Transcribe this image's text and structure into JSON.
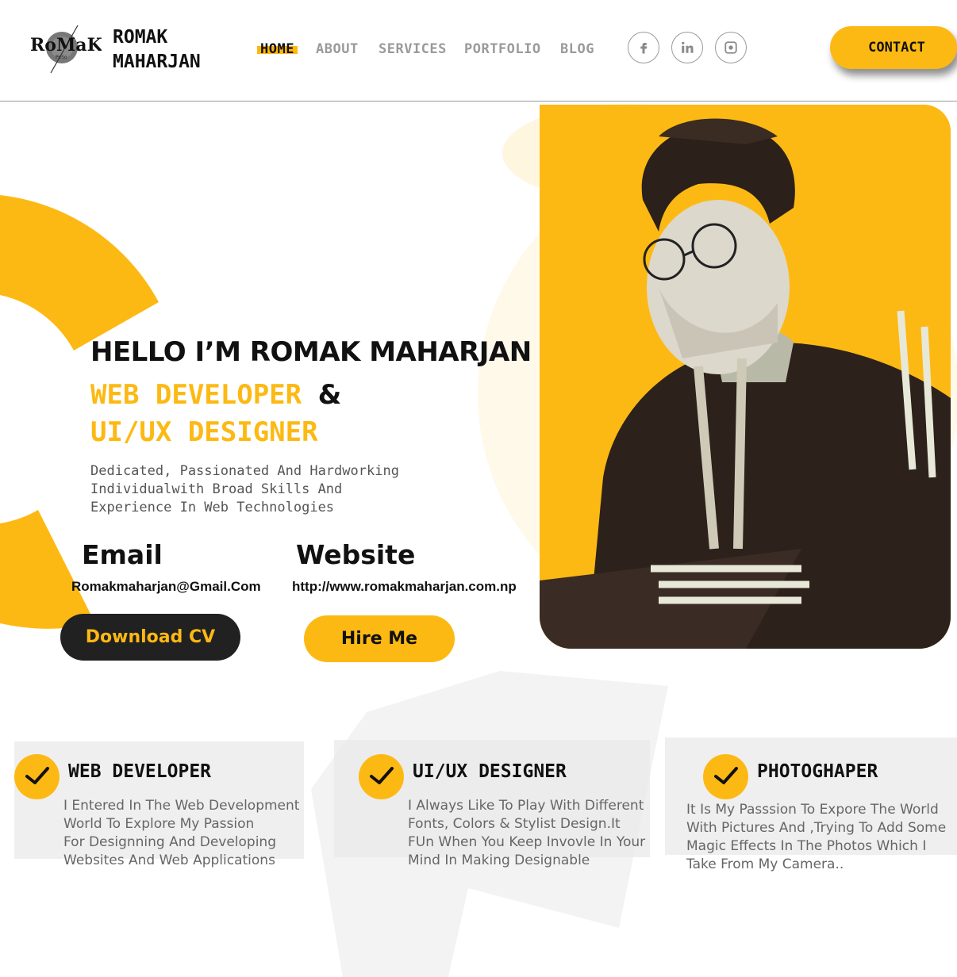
{
  "header": {
    "brand_line1": "ROMAK",
    "brand_line2": "MAHARJAN",
    "logo_text": "RoMaK",
    "logo_sub": "PoSo",
    "nav": [
      {
        "label": "HOME",
        "active": true
      },
      {
        "label": "ABOUT"
      },
      {
        "label": "SERVICES"
      },
      {
        "label": "PORTFOLIO"
      },
      {
        "label": "BLOG"
      }
    ],
    "social_icons": [
      "facebook-icon",
      "linkedin-icon",
      "github-icon"
    ],
    "contact_label": "CONTACT"
  },
  "hero": {
    "greeting": "HELLO I’M ROMAK MAHARJAN",
    "role1": "WEB DEVELOPER",
    "amp": "&",
    "role2": "UI/UX DESIGNER",
    "desc_line1": "Dedicated, Passionated And Hardworking",
    "desc_line2": "Individualwith Broad Skills And",
    "desc_line3": "Experience In Web Technologies",
    "email_label": "Email",
    "email_value": "Romakmaharjan@Gmail.Com",
    "website_label": "Website",
    "website_value": "http://www.romakmaharjan.com.np",
    "download_label": "Download CV",
    "hire_label": "Hire Me"
  },
  "services": [
    {
      "title": "WEB DEVELOPER",
      "lines": [
        "I Entered In The Web Development",
        "World To Explore My Passion",
        "For Designning And Developing",
        "Websites And Web Applications"
      ]
    },
    {
      "title": "UI/UX DESIGNER",
      "lines": [
        "I Always Like To Play With Different",
        "Fonts, Colors & Stylist Design.It",
        "FUn When You Keep Invovle In Your",
        "Mind In Making Designable"
      ]
    },
    {
      "title": "PHOTOGHAPER",
      "lines": [
        "It Is My Passsion To Expore The World",
        "With Pictures And ,Trying To Add Some",
        "Magic Effects In The Photos Which I",
        "Take From My Camera.."
      ]
    }
  ],
  "colors": {
    "accent": "#fdb913",
    "dark": "#212121",
    "muted": "#9a9a9a"
  }
}
